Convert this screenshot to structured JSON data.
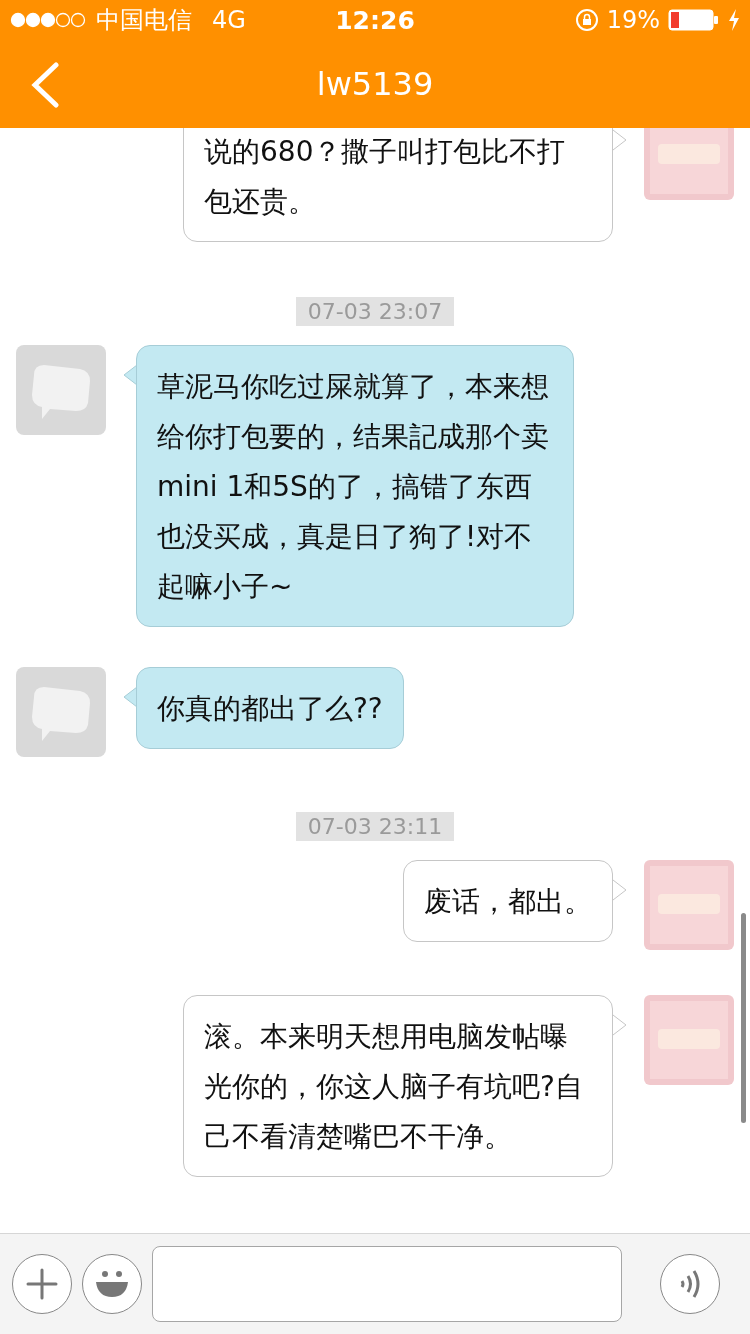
{
  "status_bar": {
    "carrier": "中国电信",
    "network": "4G",
    "time": "12:26",
    "battery": "19%"
  },
  "nav": {
    "title": "lw5139"
  },
  "messages": [
    {
      "kind": "outgoing",
      "text": "说的680？撒子叫打包比不打包还贵。"
    },
    {
      "kind": "timestamp",
      "text": "07-03 23:07"
    },
    {
      "kind": "incoming",
      "text": "草泥马你吃过屎就算了，本来想给你打包要的，结果記成那个卖mini 1和5S的了，搞错了东西也没买成，真是日了狗了!对不起嘛小子~"
    },
    {
      "kind": "incoming",
      "text": "你真的都出了么??"
    },
    {
      "kind": "timestamp",
      "text": "07-03 23:11"
    },
    {
      "kind": "outgoing",
      "text": "废话，都出。"
    },
    {
      "kind": "outgoing",
      "text": "滚。本来明天想用电脑发帖曝光你的，你这人脑子有坑吧?自己不看清楚嘴巴不干净。"
    }
  ]
}
